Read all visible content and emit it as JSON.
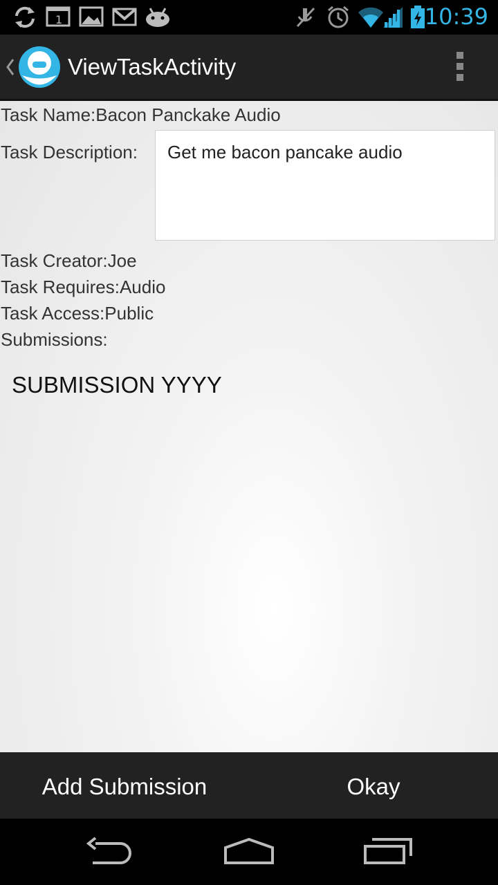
{
  "status_bar": {
    "time": "10:39",
    "icons": [
      "sync-icon",
      "calendar-icon",
      "gallery-icon",
      "gmail-icon",
      "android-icon",
      "mute-icon",
      "alarm-icon",
      "wifi-icon",
      "signal-icon",
      "battery-charging-icon"
    ],
    "calendar_day": "1",
    "accent_color": "#33b5e5"
  },
  "action_bar": {
    "title": "ViewTaskActivity",
    "icons": [
      "up-chevron-icon",
      "app-icon",
      "overflow-menu-icon"
    ]
  },
  "task": {
    "name_line": "Task Name:Bacon Panckake Audio",
    "description_label": "Task Description:",
    "description_value": "Get me bacon pancake audio",
    "creator_line": "Task Creator:Joe",
    "requires_line": "Task Requires:Audio",
    "access_line": "Task Access:Public",
    "submissions_label": "Submissions:"
  },
  "submissions": [
    "SUBMISSION YYYY"
  ],
  "buttons": {
    "add_submission": "Add Submission",
    "okay": "Okay"
  },
  "nav_bar": {
    "icons": [
      "back-icon",
      "home-icon",
      "recent-apps-icon"
    ]
  }
}
